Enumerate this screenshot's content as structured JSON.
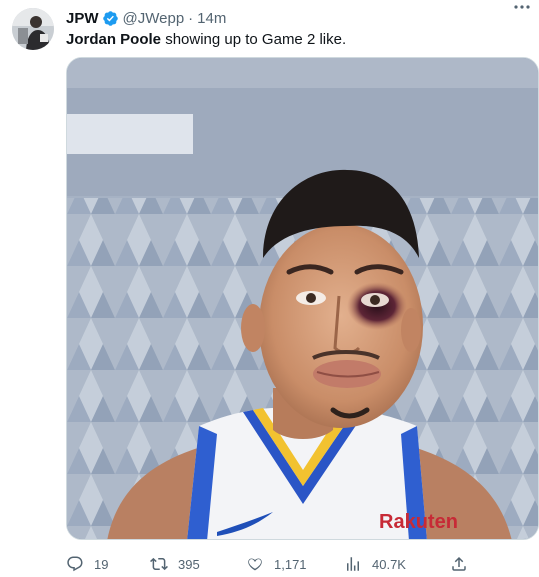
{
  "tweet": {
    "display_name": "JPW",
    "handle": "@JWepp",
    "separator": "·",
    "time": "14m",
    "text_bold": "Jordan Poole",
    "text_rest": " showing up to Game 2 like.",
    "verified_color": "#1d9bf0",
    "image_alt_jersey_sponsor": "Rakuten"
  },
  "actions": {
    "replies": "19",
    "retweets": "395",
    "likes": "1,171",
    "views": "40.7K"
  },
  "icons": [
    "more-icon",
    "verified-badge-icon",
    "reply-icon",
    "retweet-icon",
    "like-icon",
    "views-icon",
    "share-icon"
  ]
}
